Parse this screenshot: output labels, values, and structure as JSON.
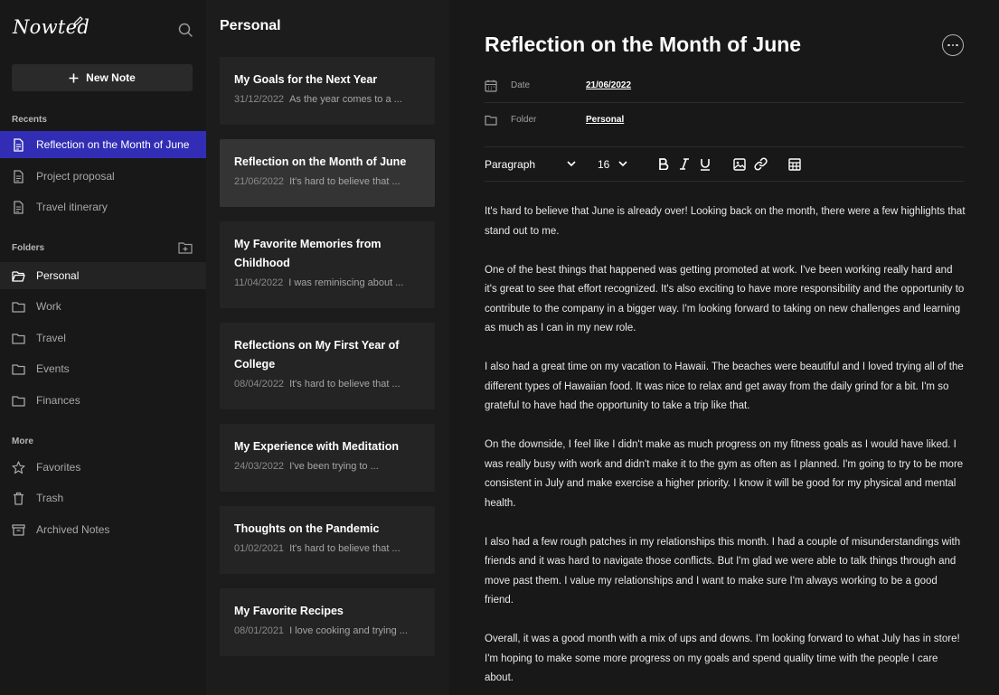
{
  "app": {
    "name": "Nowted"
  },
  "sidebar": {
    "new_note_label": "New Note",
    "recents_title": "Recents",
    "recents": [
      {
        "label": "Reflection on the Month of June",
        "icon": "document-icon"
      },
      {
        "label": "Project proposal",
        "icon": "document-icon"
      },
      {
        "label": "Travel itinerary",
        "icon": "document-icon"
      }
    ],
    "folders_title": "Folders",
    "folders": [
      {
        "label": "Personal",
        "icon": "folder-open-icon"
      },
      {
        "label": "Work",
        "icon": "folder-icon"
      },
      {
        "label": "Travel",
        "icon": "folder-icon"
      },
      {
        "label": "Events",
        "icon": "folder-icon"
      },
      {
        "label": "Finances",
        "icon": "folder-icon"
      }
    ],
    "more_title": "More",
    "more": [
      {
        "label": "Favorites",
        "icon": "star-icon"
      },
      {
        "label": "Trash",
        "icon": "trash-icon"
      },
      {
        "label": "Archived Notes",
        "icon": "archive-icon"
      }
    ]
  },
  "notes_list": {
    "folder_title": "Personal",
    "notes": [
      {
        "title": "My Goals for the Next Year",
        "date": "31/12/2022",
        "preview": "As the year comes to a ..."
      },
      {
        "title": "Reflection on the Month of June",
        "date": "21/06/2022",
        "preview": "It's hard to believe that ..."
      },
      {
        "title": "My Favorite Memories from Childhood",
        "date": "11/04/2022",
        "preview": "I was reminiscing about ..."
      },
      {
        "title": "Reflections on My First Year of College",
        "date": "08/04/2022",
        "preview": "It's hard to believe that ..."
      },
      {
        "title": "My Experience with Meditation",
        "date": "24/03/2022",
        "preview": "I've been trying to ..."
      },
      {
        "title": "Thoughts on the Pandemic",
        "date": "01/02/2021",
        "preview": "It's hard to believe that ..."
      },
      {
        "title": "My Favorite Recipes",
        "date": "08/01/2021",
        "preview": "I love cooking and trying ..."
      }
    ]
  },
  "editor": {
    "title": "Reflection on the Month of June",
    "date_label": "Date",
    "date_value": "21/06/2022",
    "folder_label": "Folder",
    "folder_value": "Personal",
    "toolbar": {
      "block_style": "Paragraph",
      "font_size": "16"
    },
    "paragraphs": [
      "It's hard to believe that June is already over! Looking back on the month, there were a few highlights that stand out to me.",
      "One of the best things that happened was getting promoted at work. I've been working really hard and it's great to see that effort recognized. It's also exciting to have more responsibility and the opportunity to contribute to the company in a bigger way. I'm looking forward to taking on new challenges and learning as much as I can in my new role.",
      "I also had a great time on my vacation to Hawaii. The beaches were beautiful and I loved trying all of the different types of Hawaiian food. It was nice to relax and get away from the daily grind for a bit. I'm so grateful to have had the opportunity to take a trip like that.",
      "On the downside, I feel like I didn't make as much progress on my fitness goals as I would have liked. I was really busy with work and didn't make it to the gym as often as I planned. I'm going to try to be more consistent in July and make exercise a higher priority. I know it will be good for my physical and mental health.",
      "I also had a few rough patches in my relationships this month. I had a couple of misunderstandings with friends and it was hard to navigate those conflicts. But I'm glad we were able to talk things through and move past them. I value my relationships and I want to make sure I'm always working to be a good friend.",
      "Overall, it was a good month with a mix of ups and downs. I'm looking forward to what July has in store! I'm hoping to make some more progress on my goals and spend quality time with the people I care about."
    ]
  },
  "colors": {
    "accent": "#312eb5",
    "background": "#181818",
    "panel": "#1c1c1c",
    "card": "#242424",
    "card_selected": "#343434"
  }
}
